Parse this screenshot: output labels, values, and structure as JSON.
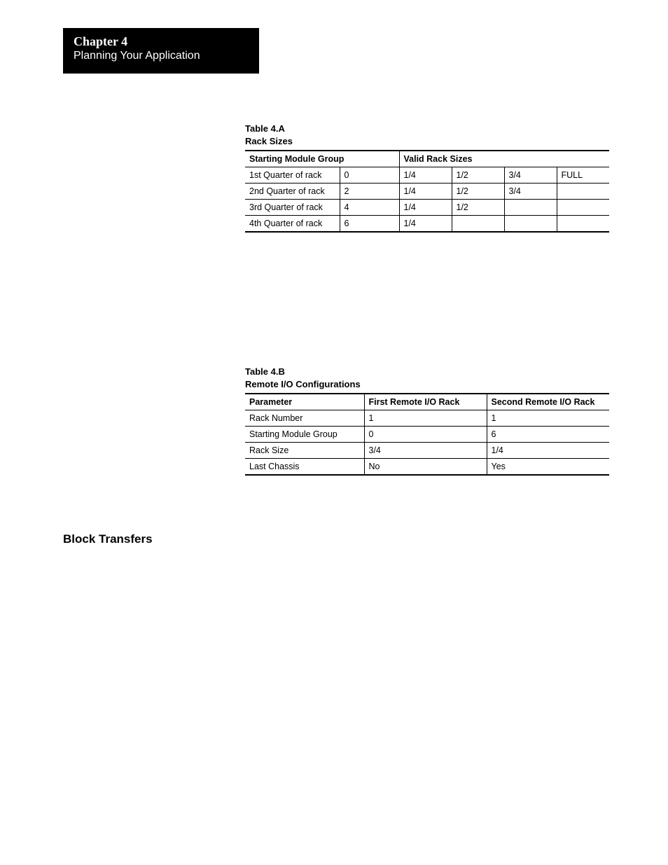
{
  "header": {
    "chapter": "Chapter 4",
    "subtitle": "Planning Your Application"
  },
  "tableA": {
    "caption_l1": "Table 4.A",
    "caption_l2": "Rack Sizes",
    "head": {
      "c1": "Starting Module Group",
      "c2": "Valid Rack Sizes"
    },
    "rows": [
      {
        "q": "1st Quarter of rack",
        "g": "0",
        "s1": "1/4",
        "s2": "1/2",
        "s3": "3/4",
        "s4": "FULL"
      },
      {
        "q": "2nd Quarter of rack",
        "g": "2",
        "s1": "1/4",
        "s2": "1/2",
        "s3": "3/4",
        "s4": ""
      },
      {
        "q": "3rd Quarter of rack",
        "g": "4",
        "s1": "1/4",
        "s2": "1/2",
        "s3": "",
        "s4": ""
      },
      {
        "q": "4th Quarter of rack",
        "g": "6",
        "s1": "1/4",
        "s2": "",
        "s3": "",
        "s4": ""
      }
    ]
  },
  "tableB": {
    "caption_l1": "Table 4.B",
    "caption_l2": "Remote I/O Configurations",
    "head": {
      "c1": "Parameter",
      "c2": "First Remote I/O Rack",
      "c3": "Second Remote I/O Rack"
    },
    "rows": [
      {
        "p": "Rack Number",
        "f": "1",
        "s": "1"
      },
      {
        "p": "Starting Module Group",
        "f": "0",
        "s": "6"
      },
      {
        "p": "Rack Size",
        "f": "3/4",
        "s": "1/4"
      },
      {
        "p": "Last Chassis",
        "f": "No",
        "s": "Yes"
      }
    ]
  },
  "section": {
    "block_transfers": "Block Transfers"
  }
}
